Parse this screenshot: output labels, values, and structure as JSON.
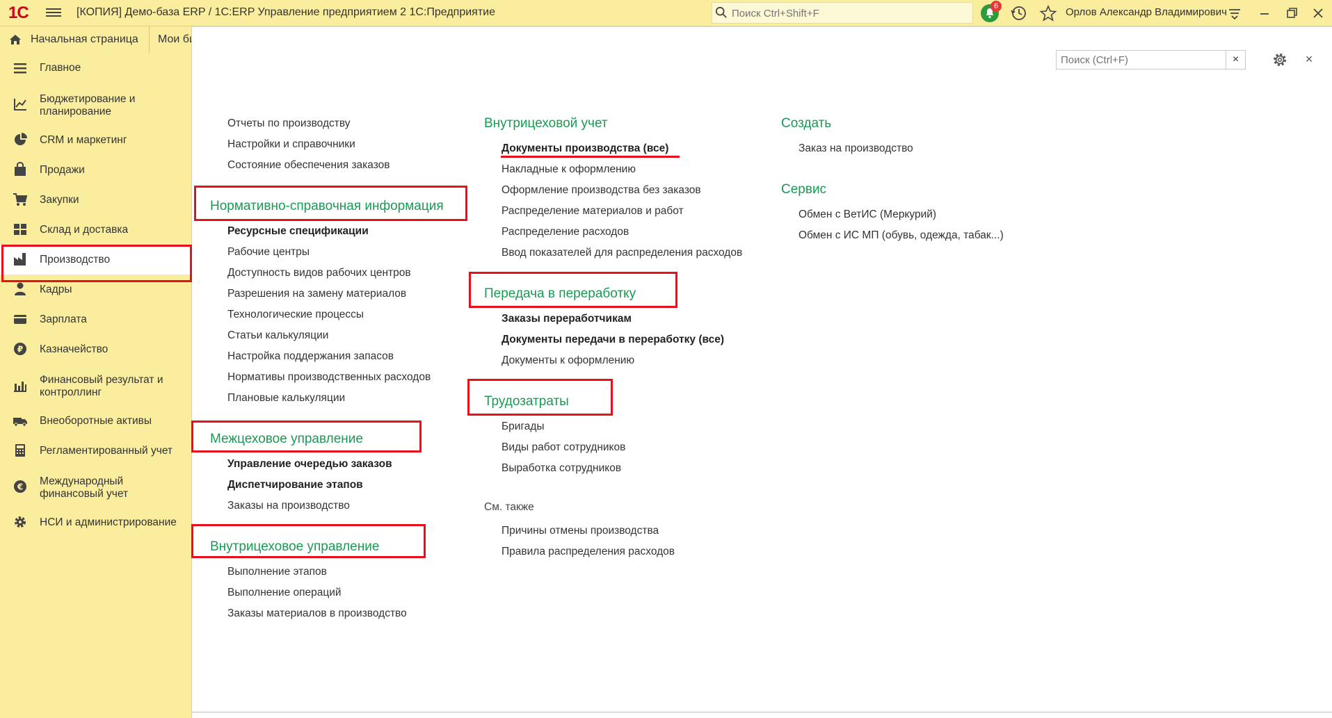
{
  "titlebar": {
    "logo": "1С",
    "title": "[КОПИЯ] Демо-база ERP / 1С:ERP Управление предприятием 2 1С:Предприятие",
    "search_placeholder": "Поиск Ctrl+Shift+F",
    "notifications_count": "6",
    "user": "Орлов Александр Владимирович"
  },
  "tabs": {
    "home": "Начальная страница",
    "my": "Мои бизнес-процессы"
  },
  "sidebar": {
    "items": [
      {
        "label": "Главное",
        "icon": "menu-lines-icon"
      },
      {
        "label": "Бюджетирование и планирование",
        "icon": "budget-icon"
      },
      {
        "label": "CRM и маркетинг",
        "icon": "pie-chart-icon"
      },
      {
        "label": "Продажи",
        "icon": "shopping-bag-icon"
      },
      {
        "label": "Закупки",
        "icon": "cart-icon"
      },
      {
        "label": "Склад и доставка",
        "icon": "warehouse-grid-icon"
      },
      {
        "label": "Производство",
        "icon": "factory-icon"
      },
      {
        "label": "Кадры",
        "icon": "person-icon"
      },
      {
        "label": "Зарплата",
        "icon": "wallet-icon"
      },
      {
        "label": "Казначейство",
        "icon": "coin-icon"
      },
      {
        "label": "Финансовый результат и контроллинг",
        "icon": "bar-chart-icon"
      },
      {
        "label": "Внеоборотные активы",
        "icon": "truck-icon"
      },
      {
        "label": "Регламентированный учет",
        "icon": "calculator-icon"
      },
      {
        "label": "Международный финансовый учет",
        "icon": "euro-icon"
      },
      {
        "label": "НСИ и администрирование",
        "icon": "gear-icon"
      }
    ]
  },
  "form": {
    "search_placeholder": "Поиск (Ctrl+F)",
    "clear": "×",
    "close": "×"
  },
  "col1": {
    "top_links": [
      "Отчеты по производству",
      "Настройки и справочники",
      "Состояние обеспечения заказов"
    ],
    "nsi_header": "Нормативно-справочная информация",
    "nsi_links": [
      "Ресурсные спецификации",
      "Рабочие центры",
      "Доступность видов рабочих центров",
      "Разрешения на замену материалов",
      "Технологические процессы",
      "Статьи калькуляции",
      "Настройка поддержания запасов",
      "Нормативы производственных расходов",
      "Плановые калькуляции"
    ],
    "mezh_header": "Межцеховое управление",
    "mezh_links": [
      "Управление очередью заказов",
      "Диспетчирование этапов",
      "Заказы на производство"
    ],
    "vnutr_header": "Внутрицеховое управление",
    "vnutr_links": [
      "Выполнение этапов",
      "Выполнение операций",
      "Заказы материалов в производство"
    ]
  },
  "col2": {
    "uchet_header": "Внутрицеховой учет",
    "uchet_links": [
      "Документы производства (все)",
      "Накладные к оформлению",
      "Оформление производства без заказов",
      "Распределение материалов и работ",
      "Распределение расходов",
      "Ввод показателей для распределения расходов"
    ],
    "pered_header": "Передача в переработку",
    "pered_links": [
      "Заказы переработчикам",
      "Документы передачи в переработку (все)",
      "Документы к оформлению"
    ],
    "trud_header": "Трудозатраты",
    "trud_links": [
      "Бригады",
      "Виды работ сотрудников",
      "Выработка сотрудников"
    ],
    "see_also": "См. также",
    "see_also_links": [
      "Причины отмены производства",
      "Правила распределения расходов"
    ]
  },
  "col3": {
    "create_header": "Создать",
    "create_links": [
      "Заказ на производство"
    ],
    "service_header": "Сервис",
    "service_links": [
      "Обмен с ВетИС (Меркурий)",
      "Обмен с ИС МП (обувь, одежда, табак...)"
    ]
  },
  "colors": {
    "panel": "#fbed9e",
    "header_green": "#1a9a52",
    "annotation_red": "#e8101a"
  }
}
